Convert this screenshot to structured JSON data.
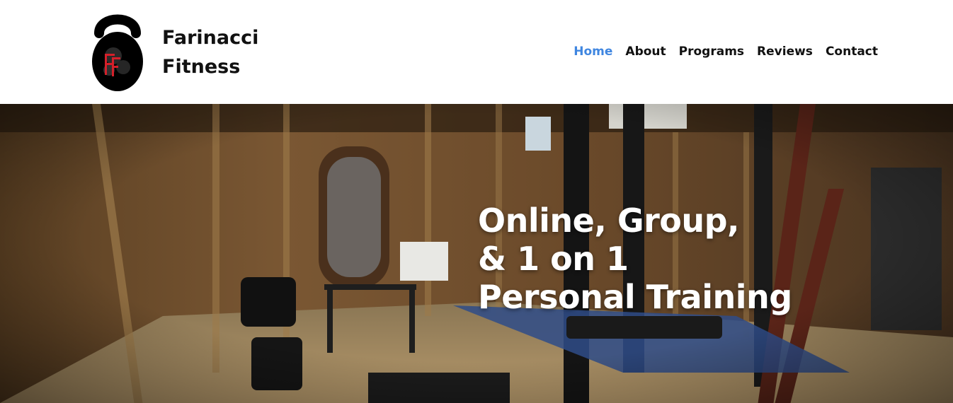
{
  "brand": {
    "line1": "Farinacci",
    "line2": "Fitness",
    "logo_text": "Farinacci Fitness",
    "logo_icon": "kettlebell-logo-icon"
  },
  "nav": {
    "items": [
      {
        "label": "Home",
        "active": true
      },
      {
        "label": "About",
        "active": false
      },
      {
        "label": "Programs",
        "active": false
      },
      {
        "label": "Reviews",
        "active": false
      },
      {
        "label": "Contact",
        "active": false
      }
    ]
  },
  "hero": {
    "line1": "Online, Group,",
    "line2": "& 1 on 1",
    "line3": "Personal Training",
    "image": "home-gym-photo"
  },
  "colors": {
    "accent": "#3f86e0",
    "text": "#111111",
    "hero_text": "#ffffff",
    "logo_red": "#d4202a"
  }
}
